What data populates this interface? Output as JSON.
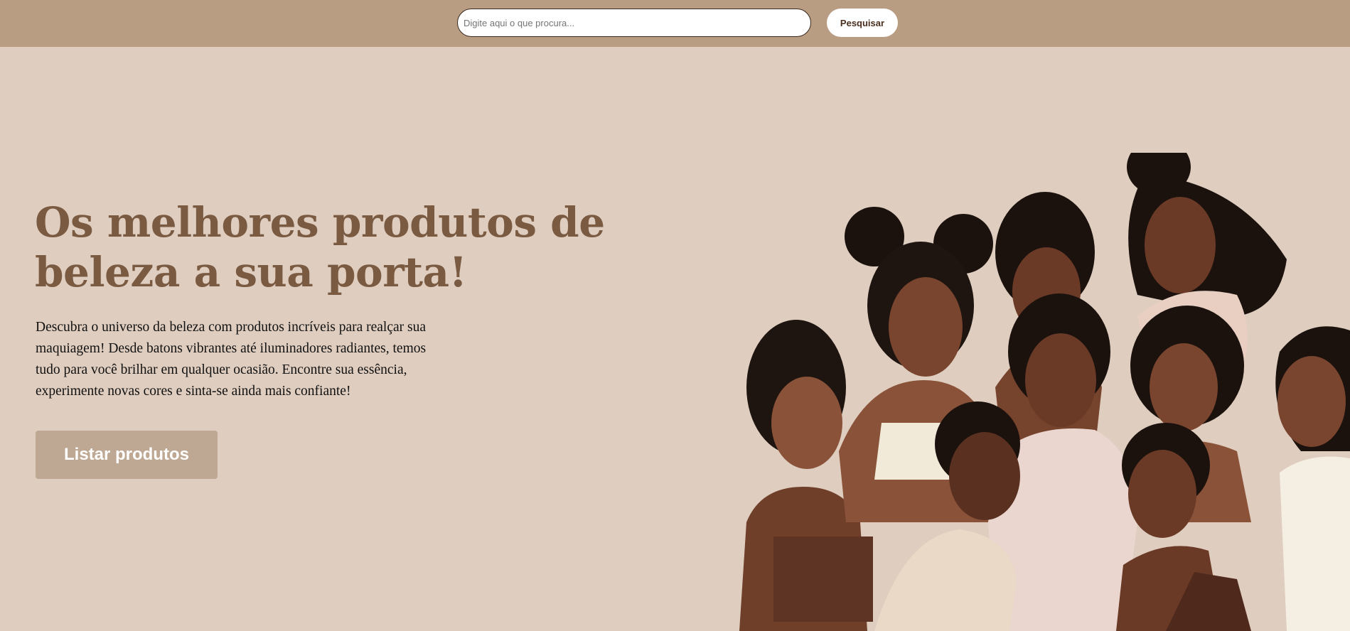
{
  "header": {
    "search_placeholder": "Digite aqui o que procura...",
    "search_value": "",
    "search_button_label": "Pesquisar"
  },
  "hero": {
    "title_line1": "Os melhores produtos de",
    "title_line2": "beleza a sua porta!",
    "description_line1": "Descubra o universo da beleza com produtos incríveis para realçar sua",
    "description_line2": "maquiagem! Desde batons vibrantes até iluminadores radiantes, temos",
    "description_line3": "tudo para você brilhar em qualquer ocasião. Encontre sua essência,",
    "description_line4": "experimente novas cores e sinta-se ainda mais confiante!",
    "cta_label": "Listar produtos"
  },
  "colors": {
    "topbar": "#b99d83",
    "page_background": "#dfcdbf",
    "title": "#7a5a41",
    "cta_background": "#bea893"
  }
}
